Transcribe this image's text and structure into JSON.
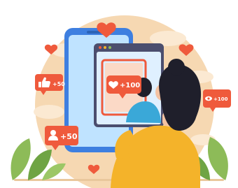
{
  "badges": {
    "likes": {
      "icon": "thumbs-up-icon",
      "text": "+50",
      "color": "#ef5a3c"
    },
    "followers": {
      "icon": "user-icon",
      "text": "+50",
      "color": "#ef5a3c"
    },
    "hearts": {
      "icon": "heart-icon",
      "text": "+100",
      "color": "#ef5a3c"
    },
    "views": {
      "icon": "eye-icon",
      "text": "+100",
      "color": "#ef5a3c"
    }
  },
  "colors": {
    "backdrop": "#f6d8b2",
    "phone": "#3e7fe0",
    "screen": "#bfe3ff",
    "accent": "#ef5a3c",
    "shirt": "#f4b32a",
    "hair": "#1f1f2b",
    "leaves": "#8dbb58"
  }
}
